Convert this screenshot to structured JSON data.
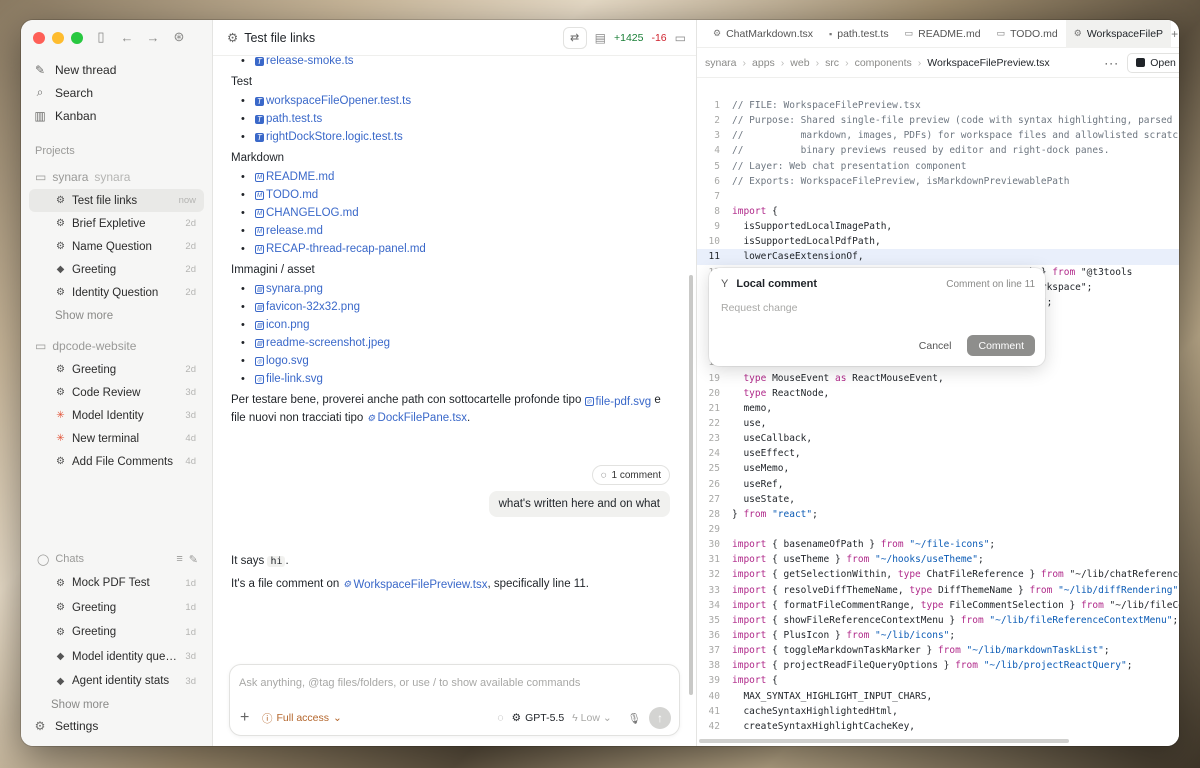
{
  "sidebar": {
    "nav": [
      {
        "label": "New thread",
        "icon": "edit-icon"
      },
      {
        "label": "Search",
        "icon": "search-icon"
      },
      {
        "label": "Kanban",
        "icon": "kanban-icon"
      }
    ],
    "projects_label": "Projects",
    "project1": {
      "name": "synara",
      "sub": "synara",
      "threads": [
        {
          "title": "Test file links",
          "age": "now",
          "active": true,
          "icon": "gear-icon"
        },
        {
          "title": "Brief Expletive",
          "age": "2d",
          "icon": "gear-icon"
        },
        {
          "title": "Name Question",
          "age": "2d",
          "icon": "gear-icon"
        },
        {
          "title": "Greeting",
          "age": "2d",
          "icon": "cube-icon"
        },
        {
          "title": "Identity Question",
          "age": "2d",
          "icon": "gear-icon"
        }
      ],
      "show_more": "Show more"
    },
    "project2": {
      "name": "dpcode-website",
      "threads": [
        {
          "title": "Greeting",
          "age": "2d",
          "icon": "gear-icon"
        },
        {
          "title": "Code Review",
          "age": "3d",
          "icon": "gear-icon"
        },
        {
          "title": "Model Identity",
          "age": "3d",
          "icon": "spark-icon"
        },
        {
          "title": "New terminal",
          "age": "4d",
          "icon": "spark-icon"
        },
        {
          "title": "Add File Comments",
          "age": "4d",
          "icon": "gear-icon"
        }
      ]
    },
    "chats": {
      "label": "Chats",
      "items": [
        {
          "title": "Mock PDF Test",
          "age": "1d",
          "icon": "gear-icon"
        },
        {
          "title": "Greeting",
          "age": "1d",
          "icon": "gear-icon"
        },
        {
          "title": "Greeting",
          "age": "1d",
          "icon": "gear-icon"
        },
        {
          "title": "Model identity questi...",
          "age": "3d",
          "icon": "cube-icon"
        },
        {
          "title": "Agent identity stats",
          "age": "3d",
          "icon": "cube-icon"
        }
      ],
      "show_more": "Show more"
    },
    "settings": "Settings"
  },
  "chat": {
    "title": "Test file links",
    "diff_add": "+1425",
    "diff_del": "-16",
    "top_item": "release-smoke.ts",
    "section_test": "Test",
    "tests": [
      "workspaceFileOpener.test.ts",
      "path.test.ts",
      "rightDockStore.logic.test.ts"
    ],
    "section_markdown": "Markdown",
    "markdown": [
      "README.md",
      "TODO.md",
      "CHANGELOG.md",
      "release.md",
      "RECAP-thread-recap-panel.md"
    ],
    "section_images": "Immagini / asset",
    "images": [
      "synara.png",
      "favicon-32x32.png",
      "icon.png",
      "readme-screenshot.jpeg",
      "logo.svg",
      "file-link.svg"
    ],
    "para_pre": "Per testare bene, proverei anche path con sottocartelle profonde tipo",
    "para_link1": "file-pdf.svg",
    "para_mid": "e file nuovi non tracciati tipo",
    "para_link2": "DockFilePane.tsx",
    "para_end": ".",
    "comment_count": "1 comment",
    "user_message": "what's written here and on what",
    "reply1_pre": "It says",
    "reply1_code": "hi",
    "reply1_end": ".",
    "reply2_pre": "It's a file comment on",
    "reply2_link": "WorkspaceFilePreview.tsx",
    "reply2_end": ", specifically line 11.",
    "composer_placeholder": "Ask anything, @tag files/folders, or use / to show available commands",
    "access": "Full access",
    "model": "GPT-5.5",
    "effort": "Low"
  },
  "editor": {
    "tabs": [
      {
        "label": "ChatMarkdown.tsx",
        "icon": "gear-icon"
      },
      {
        "label": "path.test.ts",
        "icon": "ts-icon"
      },
      {
        "label": "README.md",
        "icon": "md-icon"
      },
      {
        "label": "TODO.md",
        "icon": "md-icon"
      },
      {
        "label": "WorkspaceFileP",
        "icon": "gear-icon",
        "active": true
      }
    ],
    "breadcrumb": [
      "synara",
      "apps",
      "web",
      "src",
      "components",
      "WorkspaceFilePreview.tsx"
    ],
    "open_label": "Open",
    "code_lines": [
      {
        "n": "1",
        "t": "// FILE: WorkspaceFilePreview.tsx",
        "c": "cmt"
      },
      {
        "n": "2",
        "t": "// Purpose: Shared single-file preview (code with syntax highlighting, parsed",
        "c": "cmt"
      },
      {
        "n": "3",
        "t": "//          markdown, images, PDFs) for workspace files and allowlisted scratch",
        "c": "cmt"
      },
      {
        "n": "4",
        "t": "//          binary previews reused by editor and right-dock panes.",
        "c": "cmt"
      },
      {
        "n": "5",
        "t": "// Layer: Web chat presentation component",
        "c": "cmt"
      },
      {
        "n": "6",
        "t": "// Exports: WorkspaceFilePreview, isMarkdownPreviewablePath",
        "c": "cmt"
      },
      {
        "n": "7",
        "t": "",
        "c": "tx"
      },
      {
        "n": "8",
        "t": "import {",
        "c": "imp"
      },
      {
        "n": "9",
        "t": "  isSupportedLocalImagePath,",
        "c": "tx"
      },
      {
        "n": "10",
        "t": "  isSupportedLocalPdfPath,",
        "c": "tx"
      },
      {
        "n": "11",
        "t": "  lowerCaseExtensionOf,",
        "c": "tx",
        "hl": true
      },
      {
        "n": "12",
        "t": "",
        "c": "tx"
      },
      {
        "n": "13",
        "t": "",
        "c": "tx"
      },
      {
        "n": "14",
        "t": "",
        "c": "tx"
      },
      {
        "n": "15",
        "t": "",
        "c": "tx"
      },
      {
        "n": "16",
        "t": "",
        "c": "tx"
      },
      {
        "n": "17",
        "t": "",
        "c": "tx"
      },
      {
        "n": "18",
        "t": "",
        "c": "tx"
      },
      {
        "n": "19",
        "t": "  type MouseEvent as ReactMouseEvent,",
        "c": "typ"
      },
      {
        "n": "20",
        "t": "  type ReactNode,",
        "c": "typ"
      },
      {
        "n": "21",
        "t": "  memo,",
        "c": "tx"
      },
      {
        "n": "22",
        "t": "  use,",
        "c": "tx"
      },
      {
        "n": "23",
        "t": "  useCallback,",
        "c": "tx"
      },
      {
        "n": "24",
        "t": "  useEffect,",
        "c": "tx"
      },
      {
        "n": "25",
        "t": "  useMemo,",
        "c": "tx"
      },
      {
        "n": "26",
        "t": "  useRef,",
        "c": "tx"
      },
      {
        "n": "27",
        "t": "  useState,",
        "c": "tx"
      },
      {
        "n": "28",
        "t": "} from \"react\";",
        "c": "from"
      },
      {
        "n": "29",
        "t": "",
        "c": "tx"
      },
      {
        "n": "30",
        "t": "import { basenameOfPath } from \"~/file-icons\";",
        "c": "imp"
      },
      {
        "n": "31",
        "t": "import { useTheme } from \"~/hooks/useTheme\";",
        "c": "imp"
      },
      {
        "n": "32",
        "t": "import { getSelectionWithin, type ChatFileReference } from \"~/lib/chatReferences",
        "c": "imp"
      },
      {
        "n": "33",
        "t": "import { resolveDiffThemeName, type DiffThemeName } from \"~/lib/diffRendering\";",
        "c": "imp"
      },
      {
        "n": "34",
        "t": "import { formatFileCommentRange, type FileCommentSelection } from \"~/lib/fileCom",
        "c": "imp"
      },
      {
        "n": "35",
        "t": "import { showFileReferenceContextMenu } from \"~/lib/fileReferenceContextMenu\";",
        "c": "imp"
      },
      {
        "n": "36",
        "t": "import { PlusIcon } from \"~/lib/icons\";",
        "c": "imp"
      },
      {
        "n": "37",
        "t": "import { toggleMarkdownTaskMarker } from \"~/lib/markdownTaskList\";",
        "c": "imp"
      },
      {
        "n": "38",
        "t": "import { projectReadFileQueryOptions } from \"~/lib/projectReactQuery\";",
        "c": "imp"
      },
      {
        "n": "39",
        "t": "import {",
        "c": "imp"
      },
      {
        "n": "40",
        "t": "  MAX_SYNTAX_HIGHLIGHT_INPUT_CHARS,",
        "c": "tx"
      },
      {
        "n": "41",
        "t": "  cacheSyntaxHighlightedHtml,",
        "c": "tx"
      },
      {
        "n": "42",
        "t": "  createSyntaxHighlightCacheKey,",
        "c": "tx"
      }
    ],
    "behind_popover": [
      "vePath } from \"@t3tools",
      "hreadWorkspace\";",
      "t-query\";"
    ],
    "popover": {
      "title": "Local comment",
      "meta": "Comment on line 11",
      "placeholder": "Request change",
      "cancel": "Cancel",
      "submit": "Comment"
    }
  },
  "colors": {
    "accent_link": "#3a68c9",
    "diff_add": "#1a7f37",
    "diff_del": "#cf222e",
    "highlight_line": "#e9effb"
  }
}
